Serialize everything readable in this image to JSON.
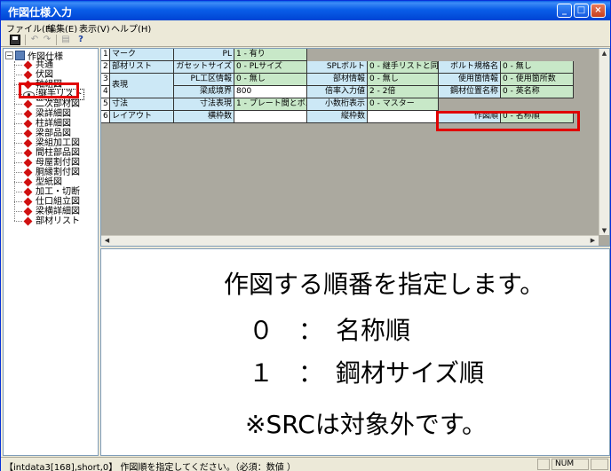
{
  "window": {
    "title": "作図仕様入力",
    "minimize": "_",
    "maximize": "□",
    "close": "×"
  },
  "menu": [
    "ファイル(F)",
    "編集(E)",
    "表示(V)",
    "ヘルプ(H)"
  ],
  "toolbar": {
    "undo": "↶",
    "redo": "↷",
    "print": "▤",
    "help": "?"
  },
  "tree": {
    "root": "作図仕様",
    "root_toggle": "−",
    "items": [
      "共通",
      "伏図",
      "軸組図",
      "継手リスト",
      "二次部材図",
      "梁詳細図",
      "柱詳細図",
      "梁部品図",
      "梁組加工図",
      "間柱部品図",
      "母屋割付図",
      "胴縁割付図",
      "型紙図",
      "加工・切断",
      "仕口組立図",
      "梁横詳細図",
      "部材リスト"
    ],
    "selected_index": 3
  },
  "grid": {
    "rows": [
      {
        "num": "1",
        "cells": [
          [
            "lbl",
            "マーク"
          ],
          [
            "key",
            "PL"
          ],
          [
            "val",
            "1 - 有り"
          ]
        ]
      },
      {
        "num": "2",
        "cells": [
          [
            "lbl",
            "部材リスト"
          ],
          [
            "key",
            "ガセットサイズ"
          ],
          [
            "val",
            "0 - PLサイズ"
          ],
          [
            "key",
            "SPLボルト"
          ],
          [
            "val",
            "0 - 継手リストと同"
          ],
          [
            "key",
            "ボルト規格名"
          ],
          [
            "val",
            "0 - 無し"
          ]
        ]
      },
      {
        "num": "3",
        "cells": [
          [
            "lbl",
            "表現"
          ],
          [
            "key",
            "PL工区情報"
          ],
          [
            "val",
            "0 - 無し"
          ],
          [
            "key",
            "部材情報"
          ],
          [
            "val",
            "0 - 無し"
          ],
          [
            "key",
            "使用箇情報"
          ],
          [
            "val",
            "0 - 使用箇所数"
          ]
        ]
      },
      {
        "num": "4",
        "cells": [
          [
            "key",
            "梁成境界"
          ],
          [
            "wht",
            "800"
          ],
          [
            "key",
            "倍率入力値"
          ],
          [
            "val",
            "2 - 2倍"
          ],
          [
            "key",
            "鋼材位置名称"
          ],
          [
            "val",
            "0 - 英名称"
          ]
        ]
      },
      {
        "num": "5",
        "cells": [
          [
            "lbl",
            "寸法"
          ],
          [
            "key",
            "寸法表現"
          ],
          [
            "val",
            "1 - プレート間とボルト間"
          ],
          [
            "key",
            "小数桁表示"
          ],
          [
            "val",
            "0 - マスター"
          ]
        ]
      },
      {
        "num": "6",
        "cells": [
          [
            "lbl",
            "レイアウト"
          ],
          [
            "key",
            "横枠数"
          ],
          [
            "wht",
            ""
          ],
          [
            "key",
            "縦枠数"
          ],
          [
            "wht",
            ""
          ],
          [
            "key",
            "作図順"
          ],
          [
            "val",
            "0 - 名称順"
          ]
        ]
      }
    ]
  },
  "help": {
    "line1": "作図する順番を指定します。",
    "line2": "０　：　名称順",
    "line3": "１　：　鋼材サイズ順",
    "line4": "※SRCは対象外です。"
  },
  "status": {
    "message": "【intdata3[168],short,0】 作図順を指定してください。（必須：数値 ）",
    "num": "NUM"
  }
}
